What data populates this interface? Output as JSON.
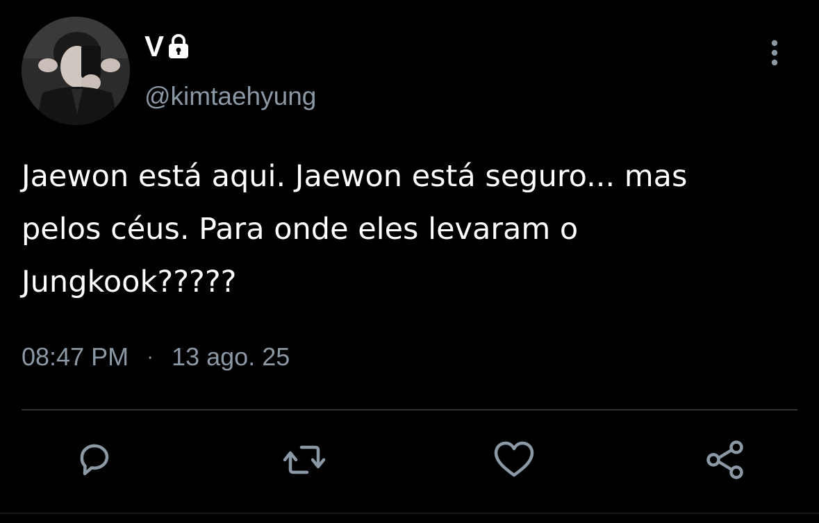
{
  "user": {
    "display_name": "V",
    "handle": "@kimtaehyung",
    "protected_icon": "lock-icon",
    "avatar_icon": "avatar-photo"
  },
  "tweet": {
    "text": "Jaewon está aqui. Jaewon está seguro... mas\npelos céus. Para onde eles levaram o\nJungkook?????",
    "time": "08:47 PM",
    "separator": "·",
    "date": "13 ago. 25"
  },
  "actions": [
    {
      "name": "reply",
      "icon": "reply-icon"
    },
    {
      "name": "retweet",
      "icon": "retweet-icon"
    },
    {
      "name": "like",
      "icon": "heart-icon"
    },
    {
      "name": "share",
      "icon": "share-icon"
    }
  ],
  "menu": {
    "icon": "more-vertical-icon"
  },
  "colors": {
    "background": "#000000",
    "text": "#ffffff",
    "secondary_text": "#8b98a5",
    "divider": "#2f3336",
    "icon": "#8b98a5"
  }
}
